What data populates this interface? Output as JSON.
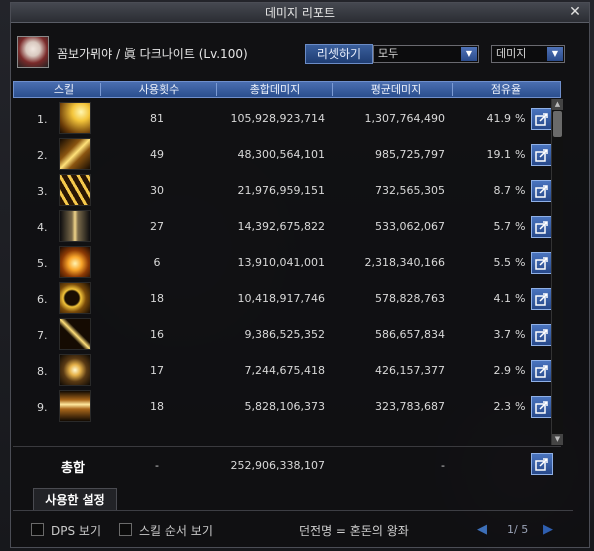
{
  "window": {
    "title": "데미지 리포트",
    "close_glyph": "✕"
  },
  "character": {
    "name": "꼼보가뮈야 / 眞 다크나이트 (Lv.100)"
  },
  "controls": {
    "reset_label": "리셋하기",
    "filter_value": "모두",
    "sort_value": "데미지",
    "dropdown_arrow": "▼"
  },
  "table": {
    "headers": {
      "skill": "스킬",
      "uses": "사용횟수",
      "total": "총합데미지",
      "avg": "평균데미지",
      "share": "점유율"
    },
    "percent_sign": "%",
    "rows": [
      {
        "rank": "1.",
        "uses": "81",
        "total": "105,928,923,714",
        "avg": "1,307,764,490",
        "share": "41.9",
        "icon": "skill-icon-slash-gold"
      },
      {
        "rank": "2.",
        "uses": "49",
        "total": "48,300,564,101",
        "avg": "985,725,797",
        "share": "19.1",
        "icon": "skill-icon-wave-gold"
      },
      {
        "rank": "3.",
        "uses": "30",
        "total": "21,976,959,151",
        "avg": "732,565,305",
        "share": "8.7",
        "icon": "skill-icon-multi-slash"
      },
      {
        "rank": "4.",
        "uses": "27",
        "total": "14,392,675,822",
        "avg": "533,062,067",
        "share": "5.7",
        "icon": "skill-icon-swords"
      },
      {
        "rank": "5.",
        "uses": "6",
        "total": "13,910,041,001",
        "avg": "2,318,340,166",
        "share": "5.5",
        "icon": "skill-icon-explosion"
      },
      {
        "rank": "6.",
        "uses": "18",
        "total": "10,418,917,746",
        "avg": "578,828,763",
        "share": "4.1",
        "icon": "skill-icon-crescent"
      },
      {
        "rank": "7.",
        "uses": "16",
        "total": "9,386,525,352",
        "avg": "586,657,834",
        "share": "3.7",
        "icon": "skill-icon-cross-slash"
      },
      {
        "rank": "8.",
        "uses": "17",
        "total": "7,244,675,418",
        "avg": "426,157,377",
        "share": "2.9",
        "icon": "skill-icon-burst"
      },
      {
        "rank": "9.",
        "uses": "18",
        "total": "5,828,106,373",
        "avg": "323,783,687",
        "share": "2.3",
        "icon": "skill-icon-flame-pillar"
      }
    ],
    "total": {
      "label": "총합",
      "uses": "-",
      "damage": "252,906,338,107",
      "avg": "-"
    }
  },
  "scrollbar": {
    "up": "▲",
    "down": "▼"
  },
  "tabs": {
    "used_settings": "사용한 설정"
  },
  "footer": {
    "dps_label": "DPS 보기",
    "skill_order_label": "스킬 순서 보기",
    "dungeon": "던전명 = 혼돈의 왕좌",
    "prev_glyph": "◀",
    "page": "1/ 5",
    "next_glyph": "▶"
  },
  "colors": {
    "header_blue": "#3a5f9c",
    "accent_blue": "#4a74be",
    "gold": "#f3c43a"
  }
}
